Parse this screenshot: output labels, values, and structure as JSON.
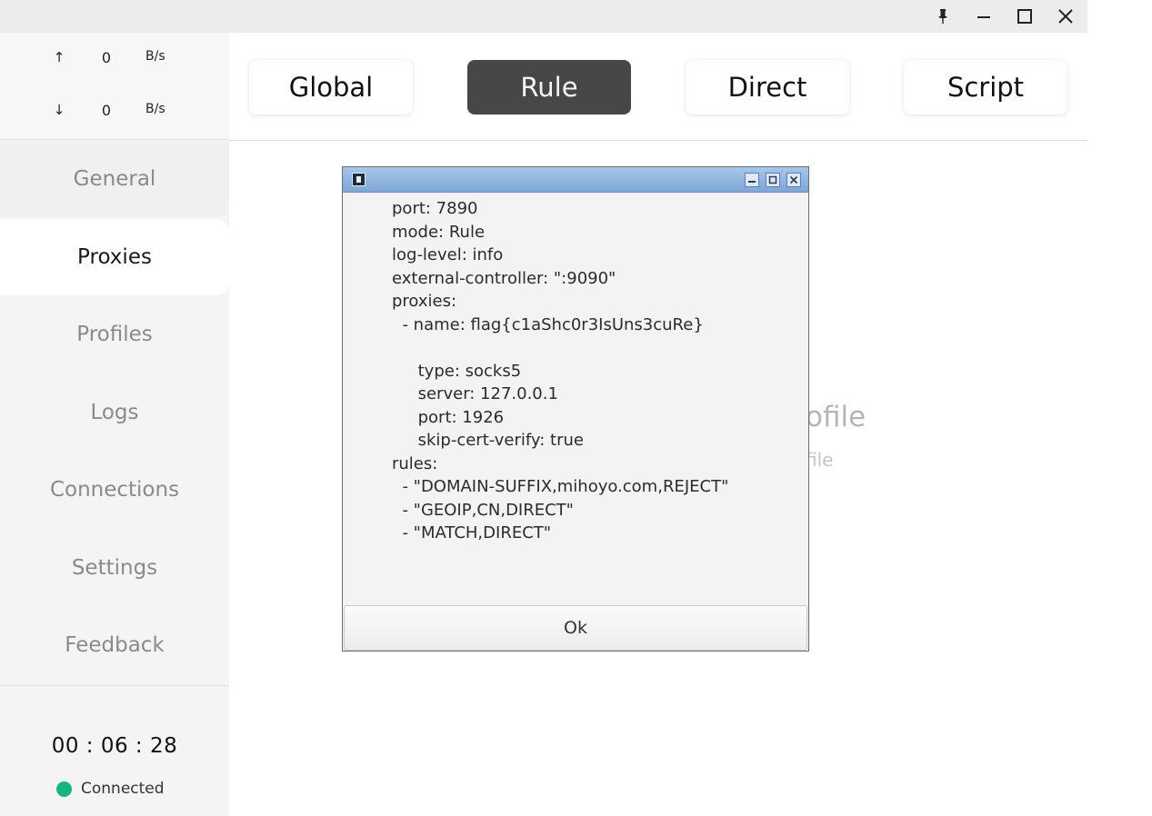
{
  "sidebar": {
    "upload_arrow": "↑",
    "upload_value": "0",
    "upload_unit": "B/s",
    "download_arrow": "↓",
    "download_value": "0",
    "download_unit": "B/s",
    "nav": [
      {
        "label": "General"
      },
      {
        "label": "Proxies"
      },
      {
        "label": "Profiles"
      },
      {
        "label": "Logs"
      },
      {
        "label": "Connections"
      },
      {
        "label": "Settings"
      },
      {
        "label": "Feedback"
      }
    ],
    "active_nav": "Proxies",
    "timer": "00 : 06 : 28",
    "status_text": "Connected",
    "status_color": "#18b57a"
  },
  "modes": [
    {
      "label": "Global"
    },
    {
      "label": "Rule"
    },
    {
      "label": "Direct"
    },
    {
      "label": "Script"
    }
  ],
  "active_mode": "Rule",
  "background": {
    "title_fragment": "ofile",
    "subtitle_fragment": "file"
  },
  "dialog": {
    "lines": [
      "port: 7890",
      "mode: Rule",
      "log-level: info",
      "external-controller: \":9090\"",
      "proxies:",
      "  - name: flag{c1aShc0r3IsUns3cuRe}",
      "",
      "     type: socks5",
      "     server: 127.0.0.1",
      "     port: 1926",
      "     skip-cert-verify: true",
      "rules:",
      "  - \"DOMAIN-SUFFIX,mihoyo.com,REJECT\"",
      "  - \"GEOIP,CN,DIRECT\"",
      "  - \"MATCH,DIRECT\""
    ],
    "ok_label": "Ok"
  },
  "icons": {
    "pin": "pin-icon",
    "minimize": "minimize-icon",
    "maximize": "maximize-icon",
    "close": "close-icon"
  },
  "colors": {
    "active_mode_bg": "#474747",
    "dialog_title_bg": "#8fb3df"
  }
}
